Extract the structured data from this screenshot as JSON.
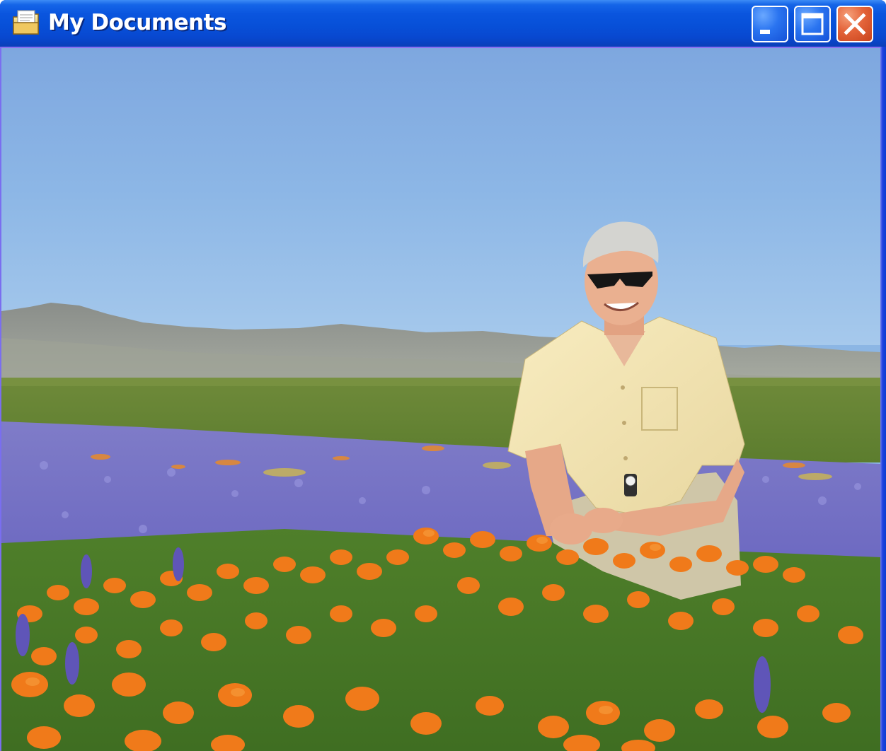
{
  "window": {
    "title": "My Documents",
    "icon": "folder-icon",
    "controls": {
      "minimize_icon": "minimize-icon",
      "maximize_icon": "maximize-icon",
      "close_icon": "close-icon"
    }
  },
  "photo": {
    "subject": "photograph"
  },
  "colors": {
    "titlebar": "#0a55de",
    "close_button": "#e4643a",
    "sky": "#8cb6e4",
    "poppy": "#f07a1a",
    "lupine": "#7a74d0",
    "grass": "#5a8a2a"
  }
}
